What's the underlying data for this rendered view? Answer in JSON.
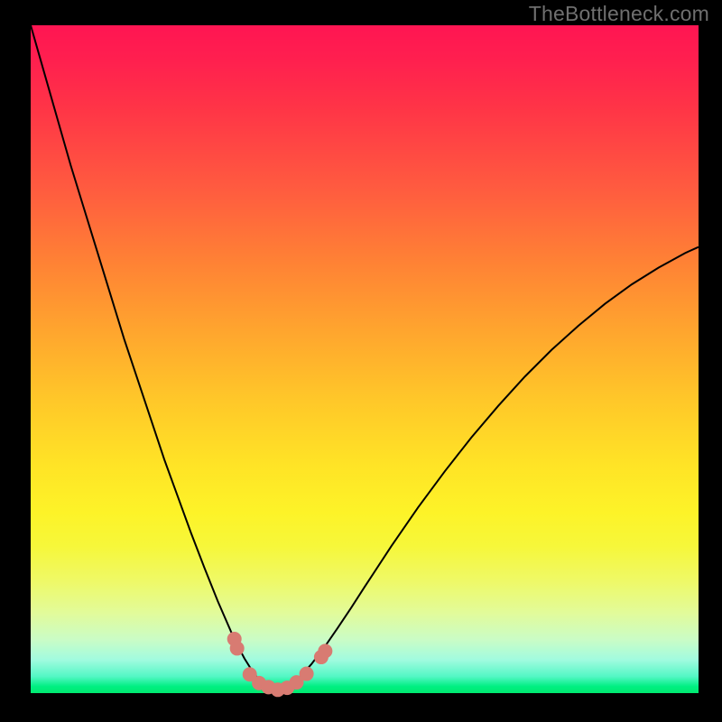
{
  "watermark": "TheBottleneck.com",
  "colors": {
    "background": "#000000",
    "gradient_top": "#ff1552",
    "gradient_bottom": "#00ea6f",
    "curve": "#000000",
    "marker": "#d87b72"
  },
  "chart_data": {
    "type": "line",
    "title": "",
    "xlabel": "",
    "ylabel": "",
    "xlim": [
      0,
      100
    ],
    "ylim": [
      0,
      100
    ],
    "x": [
      0,
      2,
      4,
      6,
      8,
      10,
      12,
      14,
      16,
      18,
      20,
      22,
      24,
      26,
      28,
      30,
      31,
      32,
      33,
      34,
      35,
      36,
      37,
      38,
      39,
      40,
      42,
      44,
      46,
      48,
      50,
      54,
      58,
      62,
      66,
      70,
      74,
      78,
      82,
      86,
      90,
      94,
      98,
      100
    ],
    "y": [
      100,
      93,
      86,
      79,
      72.5,
      66,
      59.5,
      53,
      47,
      41,
      35,
      29.5,
      24,
      18.8,
      13.8,
      9.2,
      7.1,
      5.2,
      3.6,
      2.2,
      1.2,
      0.6,
      0.4,
      0.6,
      1.2,
      2.1,
      4.3,
      6.9,
      9.8,
      12.8,
      15.9,
      22.0,
      27.8,
      33.2,
      38.3,
      43.0,
      47.4,
      51.4,
      55.0,
      58.3,
      61.2,
      63.7,
      65.9,
      66.8
    ],
    "minimum_x": 37,
    "markers": {
      "x": [
        30.5,
        30.9,
        32.8,
        34.2,
        35.6,
        37.0,
        38.4,
        39.8,
        41.3,
        43.5,
        44.1
      ],
      "y": [
        8.1,
        6.7,
        2.8,
        1.5,
        0.9,
        0.5,
        0.8,
        1.6,
        2.9,
        5.4,
        6.3
      ]
    }
  }
}
